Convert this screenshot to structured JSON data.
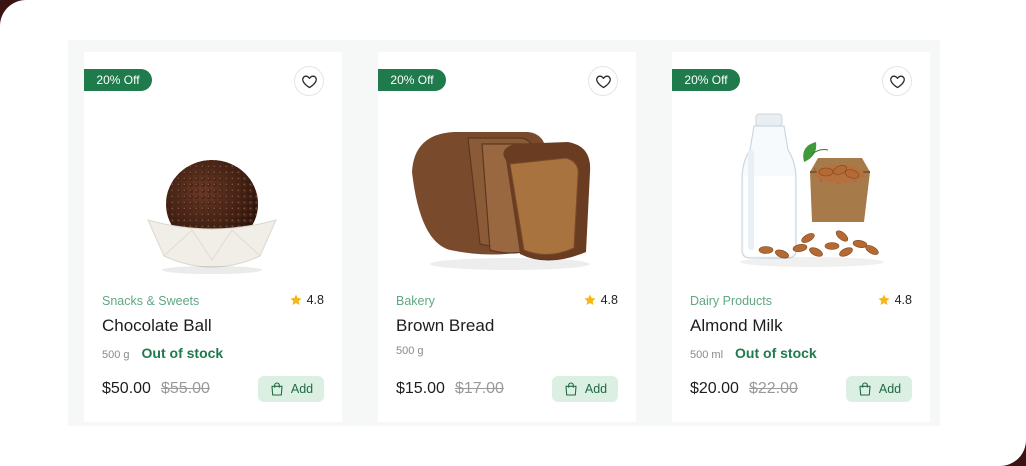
{
  "colors": {
    "accent": "#1f7a4c",
    "accent_soft": "#dcefe3",
    "category": "#5fa882",
    "star": "#f3b81b"
  },
  "products": [
    {
      "discount": "20% Off",
      "category": "Snacks & Sweets",
      "rating": "4.8",
      "name": "Chocolate Ball",
      "weight": "500 g",
      "stock": "Out of stock",
      "price": "$50.00",
      "old_price": "$55.00",
      "add_label": "Add"
    },
    {
      "discount": "20% Off",
      "category": "Bakery",
      "rating": "4.8",
      "name": "Brown Bread",
      "weight": "500 g",
      "stock": "",
      "price": "$15.00",
      "old_price": "$17.00",
      "add_label": "Add"
    },
    {
      "discount": "20% Off",
      "category": "Dairy Products",
      "rating": "4.8",
      "name": "Almond Milk",
      "weight": "500 ml",
      "stock": "Out of stock",
      "price": "$20.00",
      "old_price": "$22.00",
      "add_label": "Add"
    }
  ]
}
